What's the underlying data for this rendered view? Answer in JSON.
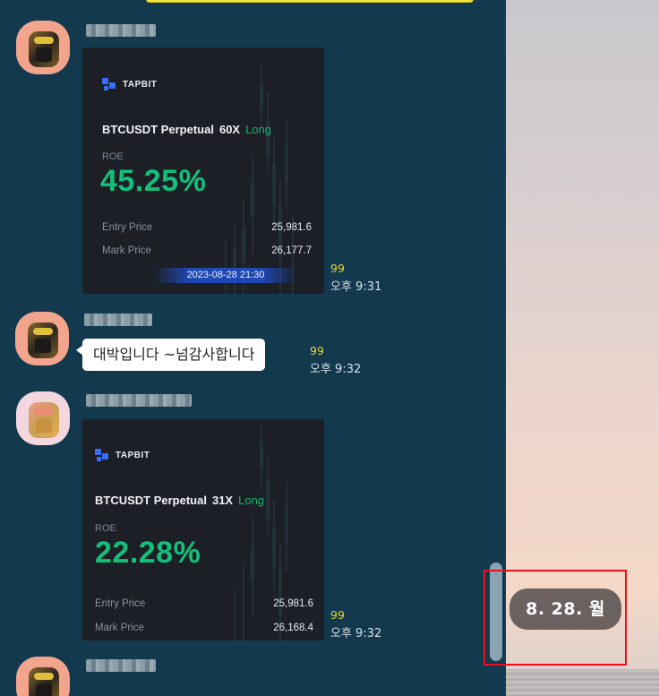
{
  "messages": [
    {
      "type": "image-card",
      "card": {
        "brand": "TAPBIT",
        "pair": "BTCUSDT Perpetual",
        "leverage": "60X",
        "side": "Long",
        "roe_label": "ROE",
        "roe_value": "45.25%",
        "entry_label": "Entry Price",
        "entry_value": "25,981.6",
        "mark_label": "Mark Price",
        "mark_value": "26,177.7",
        "timestamp": "2023-08-28 21:30"
      },
      "read_count": "99",
      "time": "오후 9:31"
    },
    {
      "type": "text",
      "text": "대박입니다 ~넘감사합니다",
      "read_count": "99",
      "time": "오후 9:32"
    },
    {
      "type": "image-card",
      "card": {
        "brand": "TAPBIT",
        "pair": "BTCUSDT Perpetual",
        "leverage": "31X",
        "side": "Long",
        "roe_label": "ROE",
        "roe_value": "22.28%",
        "entry_label": "Entry Price",
        "entry_value": "25,981.6",
        "mark_label": "Mark Price",
        "mark_value": "26,168.4"
      },
      "read_count": "99",
      "time": "오후 9:32"
    }
  ],
  "date_chip": "8. 28. 월",
  "colors": {
    "chat_background": "#12394e",
    "profit_green": "#12c07a",
    "read_count_yellow": "#e6d630",
    "highlight_red": "#e8111b"
  }
}
